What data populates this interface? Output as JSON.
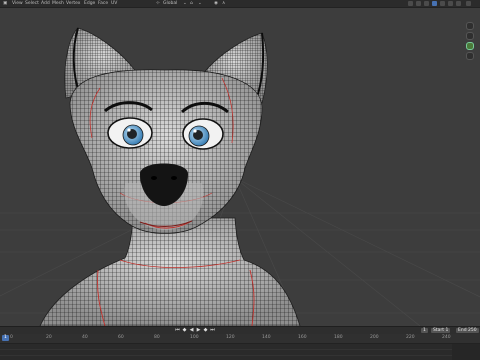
{
  "header": {
    "menus": [
      "View",
      "Select",
      "Add",
      "Mesh",
      "Vertex",
      "Edge",
      "Face",
      "UV"
    ],
    "pivot": "Global",
    "snap_icon": "magnet-icon",
    "proportional_icon": "circle-dot-icon"
  },
  "viewport": {
    "background": "#3d3d3d",
    "wire_color": "#000000",
    "seam_color": "#d0312d",
    "mesh_color": "#bfbfbf"
  },
  "timeline": {
    "ruler_ticks": [
      "0",
      "20",
      "40",
      "60",
      "80",
      "100",
      "120",
      "140",
      "160",
      "180",
      "200",
      "220",
      "240"
    ],
    "current_frame": "1",
    "start_label": "Start",
    "start_value": "1",
    "end_label": "End",
    "end_value": "250",
    "playhead_label": "1"
  }
}
